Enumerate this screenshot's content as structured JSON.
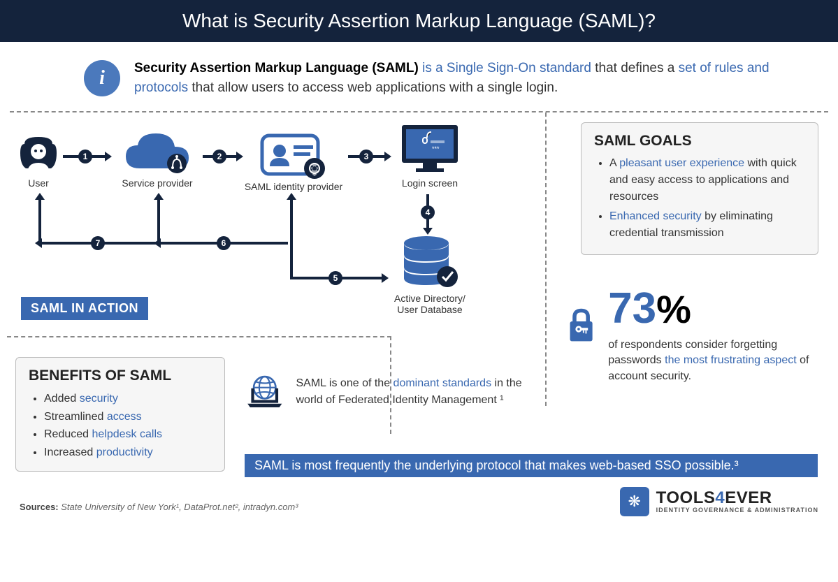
{
  "header": "What is Security Assertion Markup Language (SAML)?",
  "intro": {
    "bold": "Security Assertion Markup Language (SAML)",
    "part1": " is a Single Sign-On standard",
    "mid": " that defines a ",
    "part2": "set of rules and protocols",
    "end": " that allow users to access web applications with a single login."
  },
  "flow": {
    "user": "User",
    "sp": "Service provider",
    "idp": "SAML identity provider",
    "login": "Login screen",
    "db": "Active Directory/\nUser Database",
    "action": "SAML IN ACTION",
    "steps": [
      "1",
      "2",
      "3",
      "4",
      "5",
      "6",
      "7"
    ]
  },
  "goals": {
    "title": "SAML GOALS",
    "g1a": "pleasant user experience",
    "g1b": " with quick and easy access to applications and resources",
    "g2a": "Enhanced security",
    "g2b": " by eliminating credential transmission"
  },
  "stat": {
    "num": "73",
    "pct": "%",
    "t1": "of respondents consider forgetting passwords ",
    "t2": "the most frustrating aspect",
    "t3": " of account security."
  },
  "benefits": {
    "title": "BENEFITS OF SAML",
    "b1a": "Added ",
    "b1b": "security",
    "b2a": "Streamlined ",
    "b2b": "access",
    "b3a": "Reduced ",
    "b3b": "helpdesk calls",
    "b4a": "Increased ",
    "b4b": "productivity"
  },
  "federated": {
    "t1": "SAML is one of the ",
    "t2": "dominant standards",
    "t3": " in the world of Federated Identity Management ¹"
  },
  "bluebar": "SAML is most frequently the underlying protocol that makes web-based SSO possible.³",
  "sources": {
    "label": "Sources:",
    "text": "  State University of New York¹, DataProt.net², intradyn.com³"
  },
  "brand": {
    "name1": "TOOLS",
    "name2": "4",
    "name3": "EVER",
    "sub": "IDENTITY GOVERNANCE & ADMINISTRATION"
  }
}
